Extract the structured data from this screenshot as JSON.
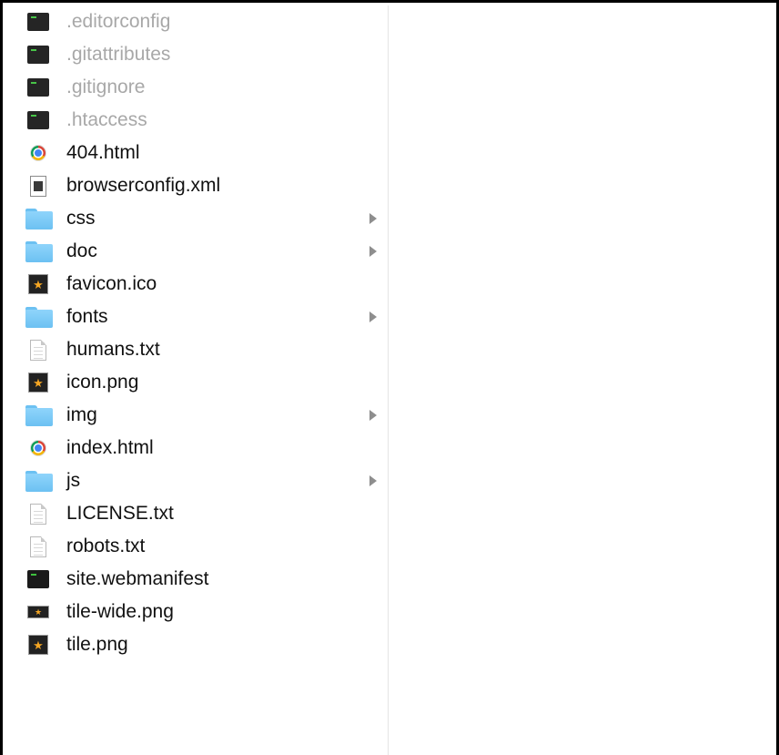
{
  "files": [
    {
      "name": ".editorconfig",
      "kind": "exec",
      "icon": "terminal-icon",
      "hidden": true,
      "folder": false
    },
    {
      "name": ".gitattributes",
      "kind": "exec",
      "icon": "terminal-icon",
      "hidden": true,
      "folder": false
    },
    {
      "name": ".gitignore",
      "kind": "exec",
      "icon": "terminal-icon",
      "hidden": true,
      "folder": false
    },
    {
      "name": ".htaccess",
      "kind": "exec",
      "icon": "terminal-icon",
      "hidden": true,
      "folder": false
    },
    {
      "name": "404.html",
      "kind": "html",
      "icon": "chrome-icon",
      "hidden": false,
      "folder": false
    },
    {
      "name": "browserconfig.xml",
      "kind": "xml",
      "icon": "xml-document-icon",
      "hidden": false,
      "folder": false
    },
    {
      "name": "css",
      "kind": "folder",
      "icon": "folder-icon",
      "hidden": false,
      "folder": true
    },
    {
      "name": "doc",
      "kind": "folder",
      "icon": "folder-icon",
      "hidden": false,
      "folder": true
    },
    {
      "name": "favicon.ico",
      "kind": "image",
      "icon": "image-icon",
      "hidden": false,
      "folder": false
    },
    {
      "name": "fonts",
      "kind": "folder",
      "icon": "folder-icon",
      "hidden": false,
      "folder": true
    },
    {
      "name": "humans.txt",
      "kind": "text",
      "icon": "text-document-icon",
      "hidden": false,
      "folder": false
    },
    {
      "name": "icon.png",
      "kind": "image",
      "icon": "image-icon",
      "hidden": false,
      "folder": false
    },
    {
      "name": "img",
      "kind": "folder",
      "icon": "folder-icon",
      "hidden": false,
      "folder": true
    },
    {
      "name": "index.html",
      "kind": "html",
      "icon": "chrome-icon",
      "hidden": false,
      "folder": false
    },
    {
      "name": "js",
      "kind": "folder",
      "icon": "folder-icon",
      "hidden": false,
      "folder": true
    },
    {
      "name": "LICENSE.txt",
      "kind": "text",
      "icon": "text-document-icon",
      "hidden": false,
      "folder": false
    },
    {
      "name": "robots.txt",
      "kind": "text",
      "icon": "text-document-icon",
      "hidden": false,
      "folder": false
    },
    {
      "name": "site.webmanifest",
      "kind": "exec",
      "icon": "terminal-icon",
      "hidden": false,
      "folder": false
    },
    {
      "name": "tile-wide.png",
      "kind": "image-wide",
      "icon": "image-icon",
      "hidden": false,
      "folder": false
    },
    {
      "name": "tile.png",
      "kind": "image",
      "icon": "image-icon",
      "hidden": false,
      "folder": false
    }
  ],
  "colors": {
    "hidden_text": "#a8a8a8",
    "text": "#111111",
    "folder": "#6cc1f2",
    "divider": "#e4e4e4"
  }
}
